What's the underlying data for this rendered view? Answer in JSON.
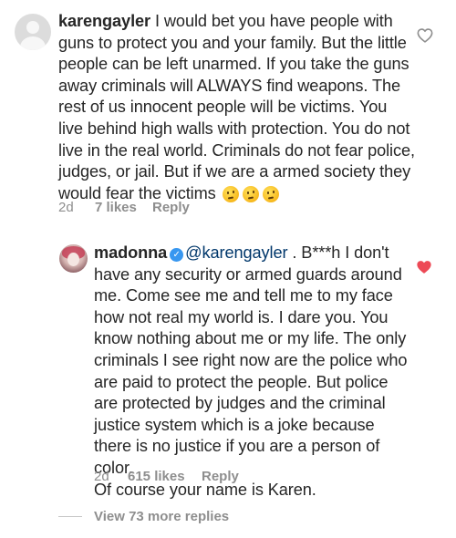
{
  "comments": [
    {
      "username": "karengayler",
      "text": " I would bet you have people with guns to protect you and your family. But the little people can be left unarmed. If you take the guns away criminals will ALWAYS find weapons. The rest of us innocent people will be victims. You live behind high walls with protection. You do not live in the real world. Criminals do not fear police, judges, or jail. But if we are a armed society they would fear the victims",
      "emojis": [
        "thinking-face",
        "thinking-face",
        "thinking-face"
      ],
      "time": "2d",
      "likes": "7 likes",
      "reply_label": "Reply",
      "liked": false,
      "avatar_icon": "default-avatar-icon"
    },
    {
      "username": "madonna",
      "verified": true,
      "mention": "@karengayler",
      "text": " . B***h I don't have any security or armed  guards around me. Come see me and tell me to my face how not real my world is. I dare you.  You know nothing about me or my life. The only criminals I see right now are the police who are paid to protect the people. But police are protected by judges and the criminal justice system which is a joke because there is no justice if you are a person of color.",
      "text_last": "Of course your name is Karen.",
      "time": "2d",
      "likes": "615 likes",
      "reply_label": "Reply",
      "liked": true,
      "verified_icon": "verified-badge-icon"
    }
  ],
  "view_replies": "View 73 more replies",
  "colors": {
    "text": "#262626",
    "secondary": "#8e8e8e",
    "mention": "#00376b",
    "like_red": "#ed4956",
    "verified_blue": "#3897f0"
  }
}
